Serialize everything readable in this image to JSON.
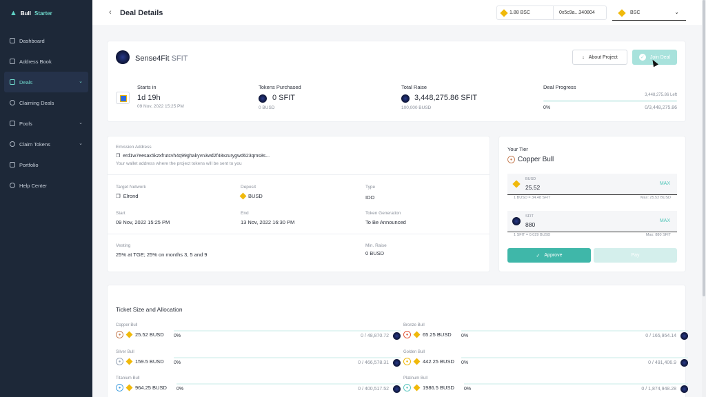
{
  "brand": {
    "name_part1": "Bull ",
    "name_part2": "Starter"
  },
  "sidebar": {
    "items": [
      {
        "label": "Dashboard",
        "icon": "grid-icon"
      },
      {
        "label": "Address Book",
        "icon": "book-icon"
      },
      {
        "label": "Deals",
        "icon": "layers-icon",
        "active": true
      },
      {
        "label": "Claiming Deals",
        "icon": "coins-icon"
      },
      {
        "label": "Pools",
        "icon": "box-icon"
      },
      {
        "label": "Claim Tokens",
        "icon": "token-icon"
      },
      {
        "label": "Portfolio",
        "icon": "briefcase-icon"
      },
      {
        "label": "Help Center",
        "icon": "help-icon"
      }
    ]
  },
  "header": {
    "title": "Deal Details",
    "balance": "1.88 BSC",
    "address": "0x5c9a...340804",
    "network": "BSC"
  },
  "project": {
    "name": "Sense4Fit",
    "symbol": "SFIT",
    "about_label": "About Project",
    "join_label": "Join Deal"
  },
  "stats": {
    "starts_label": "Starts in",
    "starts_value": "1d 19h",
    "starts_date": "09 Nov, 2022 15:25 PM",
    "tokens_label": "Tokens Purchased",
    "tokens_value": "0 SFIT",
    "tokens_sub": "0 BUSD",
    "raise_label": "Total Raise",
    "raise_value": "3,448,275.86 SFIT",
    "raise_sub": "100,000 BUSD",
    "progress_label": "Deal Progress",
    "progress_left": "3,448,275.86 Left",
    "progress_pct": "0%",
    "progress_total": "0/3,448,275.86",
    "progress_value": 0
  },
  "info": {
    "emission_label": "Emission Address",
    "emission_value": "erd1w7eesax5kzxfrutcvh4q99ghakyvn3wd2f48xzurygwd623qms8s...",
    "emission_note": "Your wallet address where the project tokens will be sent to you",
    "network_label": "Target Network",
    "network_value": "Elrond",
    "deposit_label": "Deposit",
    "deposit_value": "BUSD",
    "type_label": "Type",
    "type_value": "IDO",
    "start_label": "Start",
    "start_value": "09 Nov, 2022 15:25 PM",
    "end_label": "End",
    "end_value": "13 Nov, 2022 16:30 PM",
    "tokengen_label": "Token Generation",
    "tokengen_value": "To Be Announced",
    "vesting_label": "Vesting",
    "vesting_value": "25% at TGE; 25% on months 3, 5 and 9",
    "minraise_label": "Min. Raise",
    "minraise_value": "0 BUSD"
  },
  "tier": {
    "label": "Your Tier",
    "name": "Copper Bull",
    "busd_label": "BUSD",
    "busd_value": "25.52",
    "busd_rate": "1 BUSD = 34.48 SFIT",
    "busd_max": "Max: 25.52 BUSD",
    "sfit_label": "SFIT",
    "sfit_value": "880",
    "sfit_rate": "1 SFIT = 0.029 BUSD",
    "sfit_max": "Max: 880 SFIT",
    "max_label": "MAX",
    "approve_label": "Approve",
    "pay_label": "Pay"
  },
  "ticket": {
    "title": "Ticket Size and Allocation",
    "rows": [
      {
        "name": "Copper Bull",
        "amount": "25.52 BUSD",
        "pct": "0%",
        "cap": "0 / 48,870.72",
        "medal_color": "#c9835a"
      },
      {
        "name": "Bronze Bull",
        "amount": "65.25 BUSD",
        "pct": "0%",
        "cap": "0 / 165,954.14",
        "medal_color": "#e25a3d"
      },
      {
        "name": "Silver Bull",
        "amount": "159.5 BUSD",
        "pct": "0%",
        "cap": "0 / 466,578.31",
        "medal_color": "#9aa7b8"
      },
      {
        "name": "Golden Bull",
        "amount": "442.25 BUSD",
        "pct": "0%",
        "cap": "0 / 491,406.9",
        "medal_color": "#f0b90b"
      },
      {
        "name": "Titanium Bull",
        "amount": "964.25 BUSD",
        "pct": "0%",
        "cap": "0 / 400,517.52",
        "medal_color": "#4aa3e0"
      },
      {
        "name": "Platinum Bull",
        "amount": "1986.5 BUSD",
        "pct": "0%",
        "cap": "0 / 1,874,948.28",
        "medal_color": "#5fc7c0"
      }
    ]
  }
}
